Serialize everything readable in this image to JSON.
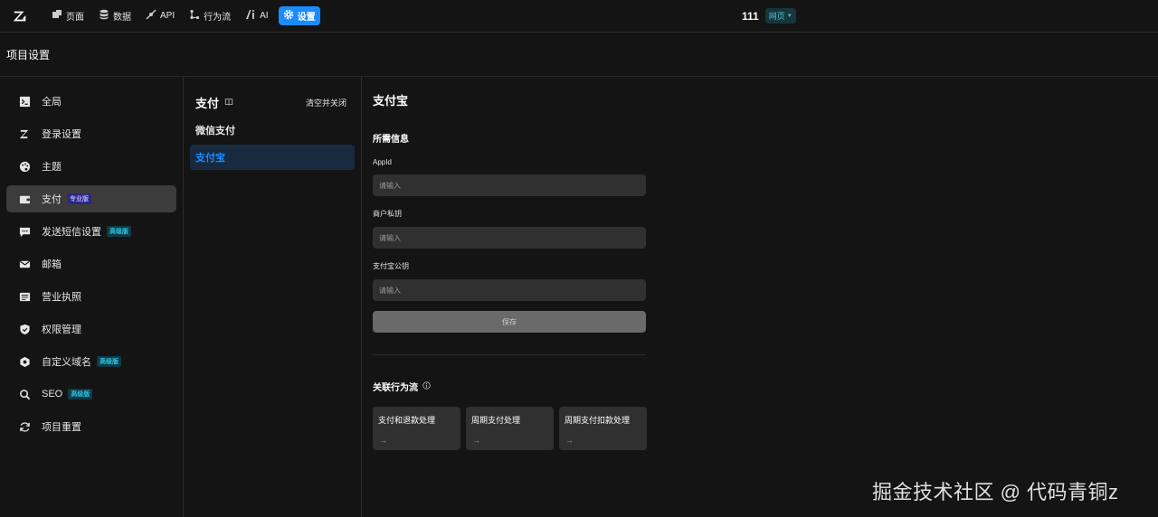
{
  "topbar": {
    "nav": [
      {
        "label": "页面",
        "icon": "page-icon"
      },
      {
        "label": "数据",
        "icon": "database-icon"
      },
      {
        "label": "API",
        "icon": "api-icon"
      },
      {
        "label": "行为流",
        "icon": "flow-icon"
      },
      {
        "label": "AI",
        "icon": "ai-icon"
      },
      {
        "label": "设置",
        "icon": "gear-icon",
        "active": true
      }
    ],
    "project_name": "111",
    "project_type": "网页"
  },
  "subbar": {
    "title": "项目设置"
  },
  "sidebar": {
    "items": [
      {
        "label": "全局",
        "icon": "terminal-icon"
      },
      {
        "label": "登录设置",
        "icon": "login-logo-icon"
      },
      {
        "label": "主题",
        "icon": "palette-icon"
      },
      {
        "label": "支付",
        "icon": "payment-icon",
        "tag": "专业版",
        "active": true
      },
      {
        "label": "发送短信设置",
        "icon": "message-icon",
        "tag": "高级版"
      },
      {
        "label": "邮箱",
        "icon": "mail-icon"
      },
      {
        "label": "营业执照",
        "icon": "license-icon"
      },
      {
        "label": "权限管理",
        "icon": "shield-icon"
      },
      {
        "label": "自定义域名",
        "icon": "domain-icon",
        "tag": "高级版"
      },
      {
        "label": "SEO",
        "icon": "search-icon",
        "tag": "高级版"
      },
      {
        "label": "项目重置",
        "icon": "reset-icon"
      }
    ]
  },
  "middle": {
    "title": "支付",
    "clear_label": "清空并关闭",
    "items": [
      {
        "label": "微信支付"
      },
      {
        "label": "支付宝",
        "active": true
      }
    ]
  },
  "panel": {
    "title": "支付宝",
    "section": "所需信息",
    "fields": [
      {
        "label": "AppId",
        "placeholder": "请输入"
      },
      {
        "label": "商户私钥",
        "placeholder": "请输入"
      },
      {
        "label": "支付宝公钥",
        "placeholder": "请输入"
      }
    ],
    "save_label": "保存",
    "flow_title": "关联行为流",
    "flows": [
      {
        "label": "支付和退款处理",
        "arrow": "→"
      },
      {
        "label": "周期支付处理",
        "arrow": "→"
      },
      {
        "label": "周期支付扣款处理",
        "arrow": "→"
      }
    ]
  },
  "watermark": "掘金技术社区 @ 代码青铜z",
  "colors": {
    "accent": "#1a8cff",
    "pro_tag": "#a9a7ff",
    "adv_tag": "#33c5e3"
  }
}
